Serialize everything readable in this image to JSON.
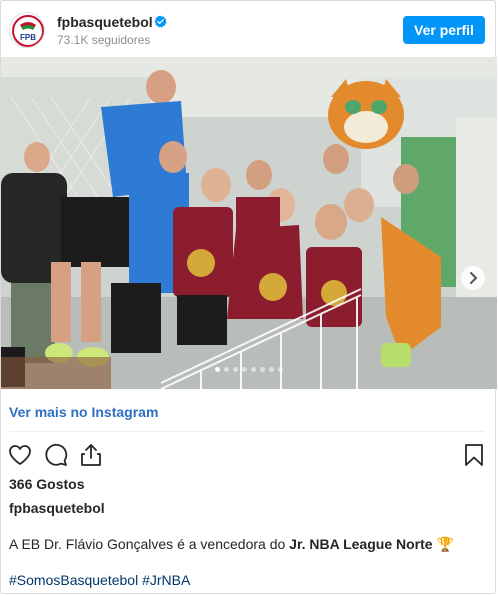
{
  "header": {
    "username": "fpbasquetebol",
    "followers": "73.1K seguidores",
    "profile_button": "Ver perfil",
    "avatar_icon": "fpb-logo-icon",
    "verified_icon": "verified-badge-icon",
    "accent_color": "#0095f6"
  },
  "photo": {
    "mascot_name_icon": "tiger-mascot",
    "carousel_dots": 8,
    "active_dot": 1
  },
  "link": {
    "ver_mais": "Ver mais no Instagram"
  },
  "actions": {
    "like_icon": "heart-icon",
    "comment_icon": "comment-icon",
    "share_icon": "share-icon",
    "save_icon": "bookmark-icon"
  },
  "post": {
    "likes": "366 Gostos",
    "caption_user": "fpbasquetebol",
    "caption_before": "A EB Dr. Flávio Gonçalves é a vencedora do ",
    "caption_bold": "Jr. NBA League Norte",
    "caption_emoji": "🏆",
    "hashtags": "#SomosBasquetebol #JrNBA"
  }
}
